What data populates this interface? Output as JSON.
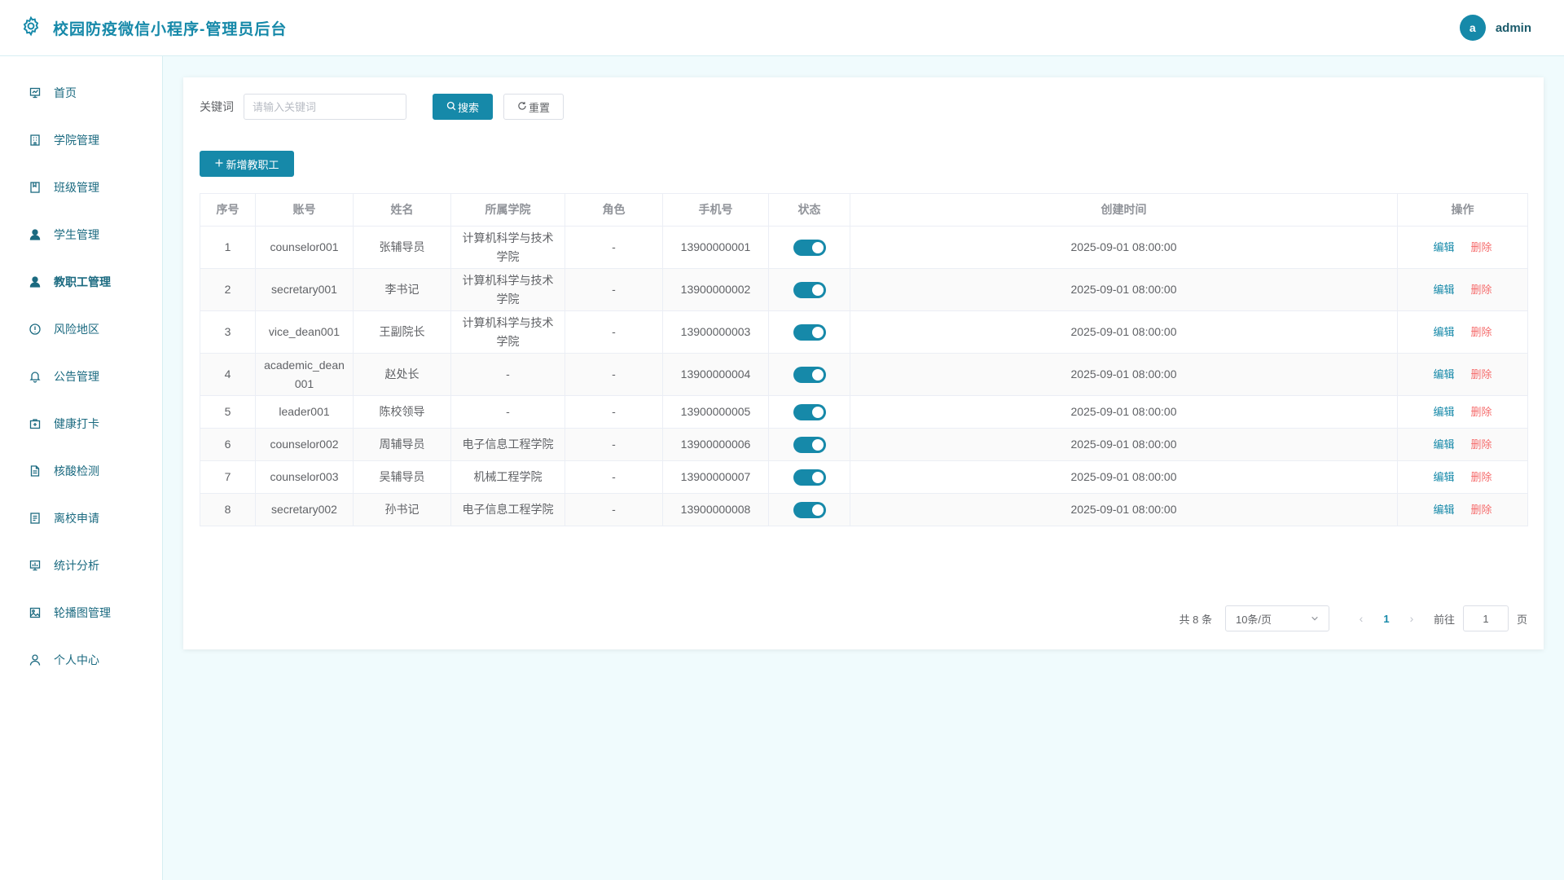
{
  "header": {
    "title": "校园防疫微信小程序-管理员后台",
    "avatar_letter": "a",
    "username": "admin"
  },
  "colors": {
    "accent": "#1689a9",
    "danger": "#f56c6c",
    "background": "#f0fbfd"
  },
  "sidebar": {
    "items": [
      {
        "label": "首页",
        "icon": "dashboard-icon"
      },
      {
        "label": "学院管理",
        "icon": "building-icon"
      },
      {
        "label": "班级管理",
        "icon": "class-icon"
      },
      {
        "label": "学生管理",
        "icon": "student-icon"
      },
      {
        "label": "教职工管理",
        "icon": "staff-icon",
        "active": true
      },
      {
        "label": "风险地区",
        "icon": "warning-icon"
      },
      {
        "label": "公告管理",
        "icon": "bell-icon"
      },
      {
        "label": "健康打卡",
        "icon": "medkit-icon"
      },
      {
        "label": "核酸检测",
        "icon": "document-icon"
      },
      {
        "label": "离校申请",
        "icon": "form-icon"
      },
      {
        "label": "统计分析",
        "icon": "chart-icon"
      },
      {
        "label": "轮播图管理",
        "icon": "image-icon"
      },
      {
        "label": "个人中心",
        "icon": "user-icon"
      }
    ]
  },
  "search": {
    "label": "关键词",
    "placeholder": "请输入关键词",
    "value": "",
    "search_label": "搜索",
    "reset_label": "重置"
  },
  "toolbar": {
    "add_label": "新增教职工"
  },
  "table": {
    "columns": [
      "序号",
      "账号",
      "姓名",
      "所属学院",
      "角色",
      "手机号",
      "状态",
      "创建时间",
      "操作"
    ],
    "edit_label": "编辑",
    "delete_label": "删除",
    "rows": [
      {
        "index": "1",
        "account": "counselor001",
        "name": "张辅导员",
        "college": "计算机科学与技术学院",
        "role": "-",
        "phone": "13900000001",
        "status": true,
        "created": "2025-09-01 08:00:00"
      },
      {
        "index": "2",
        "account": "secretary001",
        "name": "李书记",
        "college": "计算机科学与技术学院",
        "role": "-",
        "phone": "13900000002",
        "status": true,
        "created": "2025-09-01 08:00:00"
      },
      {
        "index": "3",
        "account": "vice_dean001",
        "name": "王副院长",
        "college": "计算机科学与技术学院",
        "role": "-",
        "phone": "13900000003",
        "status": true,
        "created": "2025-09-01 08:00:00"
      },
      {
        "index": "4",
        "account": "academic_dean001",
        "name": "赵处长",
        "college": "-",
        "role": "-",
        "phone": "13900000004",
        "status": true,
        "created": "2025-09-01 08:00:00"
      },
      {
        "index": "5",
        "account": "leader001",
        "name": "陈校领导",
        "college": "-",
        "role": "-",
        "phone": "13900000005",
        "status": true,
        "created": "2025-09-01 08:00:00"
      },
      {
        "index": "6",
        "account": "counselor002",
        "name": "周辅导员",
        "college": "电子信息工程学院",
        "role": "-",
        "phone": "13900000006",
        "status": true,
        "created": "2025-09-01 08:00:00"
      },
      {
        "index": "7",
        "account": "counselor003",
        "name": "吴辅导员",
        "college": "机械工程学院",
        "role": "-",
        "phone": "13900000007",
        "status": true,
        "created": "2025-09-01 08:00:00"
      },
      {
        "index": "8",
        "account": "secretary002",
        "name": "孙书记",
        "college": "电子信息工程学院",
        "role": "-",
        "phone": "13900000008",
        "status": true,
        "created": "2025-09-01 08:00:00"
      }
    ]
  },
  "pagination": {
    "total_text": "共 8 条",
    "page_size": "10条/页",
    "current_page": "1",
    "goto_label": "前往",
    "goto_value": "1",
    "page_suffix": "页"
  }
}
